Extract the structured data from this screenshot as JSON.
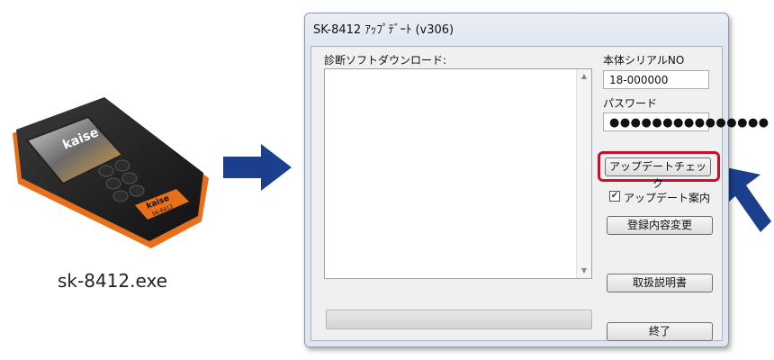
{
  "device": {
    "caption": "sk-8412.exe",
    "brand": "kaise",
    "model": "SK-8412"
  },
  "window": {
    "title": "SK-8412 ｱｯﾌﾟﾃﾞｰﾄ (v306)"
  },
  "download": {
    "label": "診断ソフトダウンロード:"
  },
  "serial": {
    "label": "本体シリアルNO",
    "value": "18-000000"
  },
  "password": {
    "label": "パスワード",
    "masked": "●●●●●●●●●●●●●●●"
  },
  "buttons": {
    "update_check": "アップデートチェック",
    "register_change": "登録内容変更",
    "manual": "取扱説明書",
    "exit": "終了"
  },
  "update_notice": {
    "label": "アップデート案内",
    "checked": true,
    "mark": "✔"
  },
  "colors": {
    "arrow": "#1b3f8c",
    "highlight": "#c8102e",
    "device_accent": "#e8701c"
  }
}
